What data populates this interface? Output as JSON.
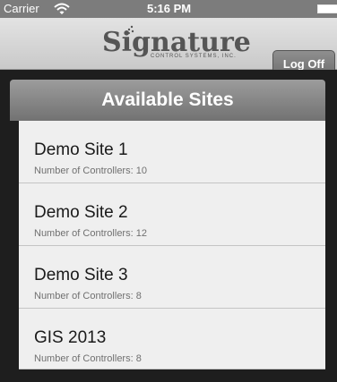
{
  "status_bar": {
    "carrier": "Carrier",
    "time": "5:16 PM"
  },
  "header": {
    "logo_word": "Signature",
    "logo_subtitle": "CONTROL SYSTEMS, INC.",
    "logoff_label": "Log Off"
  },
  "main": {
    "title": "Available Sites",
    "sites": [
      {
        "name": "Demo Site 1",
        "controllers": "Number of Controllers: 10"
      },
      {
        "name": "Demo Site 2",
        "controllers": "Number of Controllers: 12"
      },
      {
        "name": "Demo Site 3",
        "controllers": "Number of Controllers: 8"
      },
      {
        "name": "GIS 2013",
        "controllers": "Number of Controllers: 8"
      }
    ]
  },
  "icons": [
    "wifi-icon",
    "battery-icon",
    "logo-dots-icon"
  ],
  "colors": {
    "status_bar": "#7c7c7c",
    "header_gradient_top": "#e3e3e3",
    "header_gradient_bottom": "#c9c9c9",
    "button": "#7a7a7a",
    "frame": "#1e1e1e",
    "list_bg": "#efefef",
    "section_header": "#858585"
  }
}
